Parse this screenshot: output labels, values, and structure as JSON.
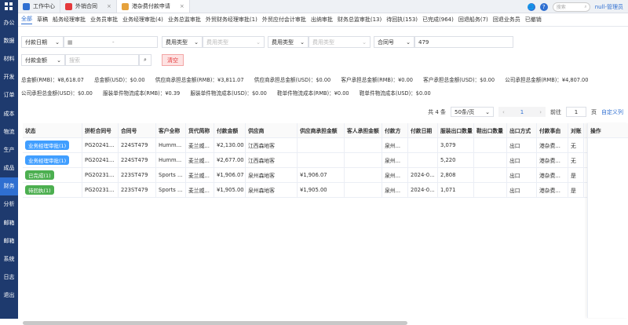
{
  "sidebar": {
    "items": [
      {
        "label": "办公"
      },
      {
        "label": "数据"
      },
      {
        "label": "材料"
      },
      {
        "label": "开发"
      },
      {
        "label": "订单"
      },
      {
        "label": "成本"
      },
      {
        "label": "物流"
      },
      {
        "label": "生产"
      },
      {
        "label": "成品"
      },
      {
        "label": "财务",
        "active": true
      },
      {
        "label": "分析"
      },
      {
        "label": "邮箱"
      },
      {
        "label": "邮箱"
      },
      {
        "label": "系统"
      },
      {
        "label": "日志"
      },
      {
        "label": "退出"
      }
    ]
  },
  "tabs": [
    {
      "label": "工作中心",
      "color": "#2f6fd1"
    },
    {
      "label": "外销合同",
      "color": "#e4393c",
      "close": "×"
    },
    {
      "label": "港杂费付款申请",
      "color": "#e6a23c",
      "close": "×",
      "active": true
    }
  ],
  "top": {
    "search_placeholder": "搜索",
    "user": "null-管理员",
    "globe": "🌐",
    "help": "?"
  },
  "subtabs": [
    "全部",
    "草稿",
    "船务经理审批",
    "业务员审批",
    "业务经理审批(4)",
    "业务总监审批",
    "外贸财务经理审批(1)",
    "外贸应付会计审批",
    "出纳审批",
    "财务总监审批(13)",
    "待回执(153)",
    "已完成(964)",
    "回退船务(7)",
    "回退业务员",
    "已撤销"
  ],
  "filters": {
    "pay_date": "付款日期",
    "date_sep": "-",
    "fee_type1": "费用类型",
    "fee_type1_ph": "费用类型",
    "fee_type2": "费用类型",
    "fee_type2_ph": "费用类型",
    "contract_no": "合同号",
    "contract_value": "479",
    "pay_amount": "付款金额",
    "search_ph": "搜索",
    "clear": "清空"
  },
  "summary": {
    "line1": "总金额(RMB)：¥8,618.07　　总金额(USD)：$0.00　　供应商承担总金额(RMB)：¥3,811.07　　供应商承担总金额(USD)：$0.00　　客户承担总金额(RMB)：¥0.00　　客户承担总金额(USD)：$0.00　　公司承担总金额(RMB)：¥4,807.00",
    "line2": "公司承担总金额(USD)：$0.00　　服装单件物流成本(RMB)：¥0.39　　服装单件物流成本(USD)：$0.00　　鞋单件物流成本(RMB)：¥0.00　　鞋单件物流成本(USD)：$0.00"
  },
  "pager": {
    "total": "共 4 条",
    "size": "50条/页",
    "current": "1",
    "goto": "前往",
    "goto_value": "1",
    "page_unit": "页",
    "custom": "自定义列"
  },
  "table": {
    "columns": [
      "状态",
      "拼柜合同号",
      "合同号",
      "客户全称",
      "货代简称",
      "付款金额",
      "供应商",
      "供应商承担金额",
      "客人承担金额",
      "付款方",
      "付款日期",
      "服装出口数量",
      "鞋出口数量",
      "出口方式",
      "付款事由",
      "对账"
    ],
    "op_header": "操作",
    "rows": [
      {
        "status": "业务经理审批(1)",
        "status_color": "#409eff",
        "cells": [
          "PG20241...",
          "224ST479",
          "Humm...",
          "麦兰威...",
          "¥2,130.00",
          "江西森地客",
          "",
          "",
          "泉州...",
          "",
          "3,079",
          "",
          "出口",
          "港杂费...",
          "无"
        ]
      },
      {
        "status": "业务经理审批(1)",
        "status_color": "#409eff",
        "cells": [
          "PG20241...",
          "224ST479",
          "Humm...",
          "麦兰威...",
          "¥2,677.00",
          "江西森地客",
          "",
          "",
          "泉州...",
          "",
          "5,220",
          "",
          "出口",
          "港杂费...",
          "无"
        ]
      },
      {
        "status": "已完成(1)",
        "status_color": "#4caf50",
        "cells": [
          "PG20231...",
          "223ST479",
          "Sports ...",
          "麦兰威...",
          "¥1,906.07",
          "泉州森地客",
          "¥1,906.07",
          "",
          "泉州...",
          "2024-0...",
          "2,808",
          "",
          "出口",
          "港杂费...",
          "是"
        ]
      },
      {
        "status": "待回执(1)",
        "status_color": "#4caf50",
        "cells": [
          "PG20231...",
          "223ST479",
          "Sports ...",
          "麦兰威...",
          "¥1,905.00",
          "泉州森地客",
          "¥1,905.00",
          "",
          "泉州...",
          "2024-0...",
          "1,071",
          "",
          "出口",
          "港杂费...",
          "是"
        ]
      }
    ]
  }
}
